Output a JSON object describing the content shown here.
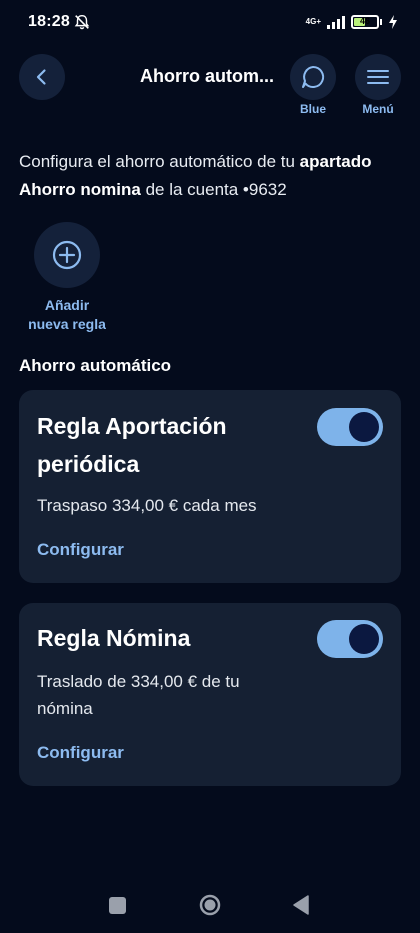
{
  "status_bar": {
    "time": "18:28",
    "network": "4G+",
    "battery_level": "46"
  },
  "header": {
    "title": "Ahorro autom...",
    "blue_label": "Blue",
    "menu_label": "Menú"
  },
  "intro": {
    "text_start": "Configura el ahorro automático de tu ",
    "bold_1": "apartado Ahorro nomina",
    "text_mid": " de la cuenta •9632"
  },
  "add_rule": {
    "line1": "Añadir",
    "line2": "nueva regla"
  },
  "section_title": "Ahorro automático",
  "rules": [
    {
      "title": "Regla Aportación periódica",
      "description": "Traspaso 334,00 € cada mes",
      "link": "Configurar",
      "enabled": true
    },
    {
      "title": "Regla Nómina",
      "description": "Traslado de 334,00 € de tu nómina",
      "link": "Configurar",
      "enabled": true
    }
  ],
  "colors": {
    "background": "#040b1c",
    "card": "#152033",
    "accent": "#8dbbf0",
    "toggle_on": "#7eb3ea"
  }
}
